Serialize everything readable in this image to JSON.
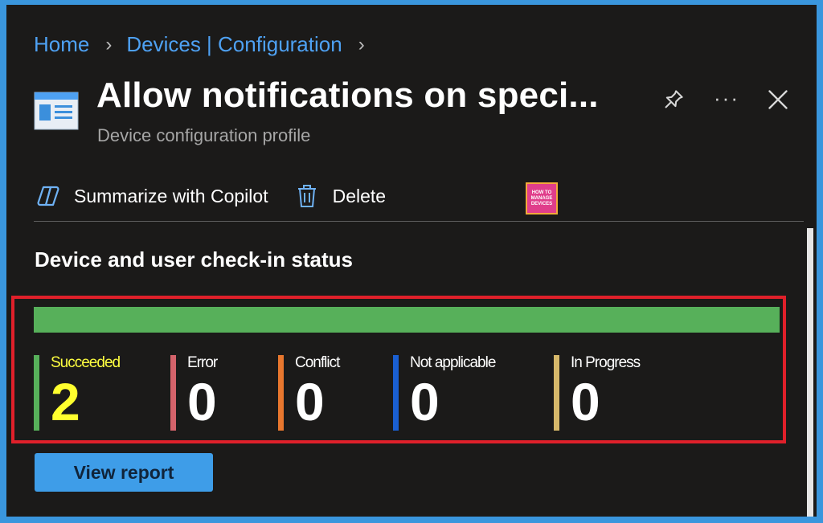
{
  "breadcrumb": [
    {
      "label": "Home"
    },
    {
      "label": "Devices | Configuration"
    }
  ],
  "header": {
    "title": "Allow notifications on speci...",
    "subtitle": "Device configuration profile",
    "more_label": "···"
  },
  "toolbar": {
    "summarize_label": "Summarize with Copilot",
    "delete_label": "Delete",
    "logo_lines": [
      "HOW TO",
      "MANAGE",
      "DEVICES"
    ]
  },
  "section": {
    "title": "Device and user check-in status"
  },
  "status_bar": {
    "succeeded_fraction": 1.0
  },
  "stats": [
    {
      "label": "Succeeded",
      "value": "2",
      "color": "#57b05a"
    },
    {
      "label": "Error",
      "value": "0",
      "color": "#d4636b"
    },
    {
      "label": "Conflict",
      "value": "0",
      "color": "#e8772e"
    },
    {
      "label": "Not applicable",
      "value": "0",
      "color": "#1a5fd1"
    },
    {
      "label": "In Progress",
      "value": "0",
      "color": "#d6b86a"
    }
  ],
  "actions": {
    "view_report_label": "View report"
  },
  "colors": {
    "accent": "#4ea1f3",
    "highlight_border": "#e0202a",
    "highlight_text": "#ffff2e"
  }
}
